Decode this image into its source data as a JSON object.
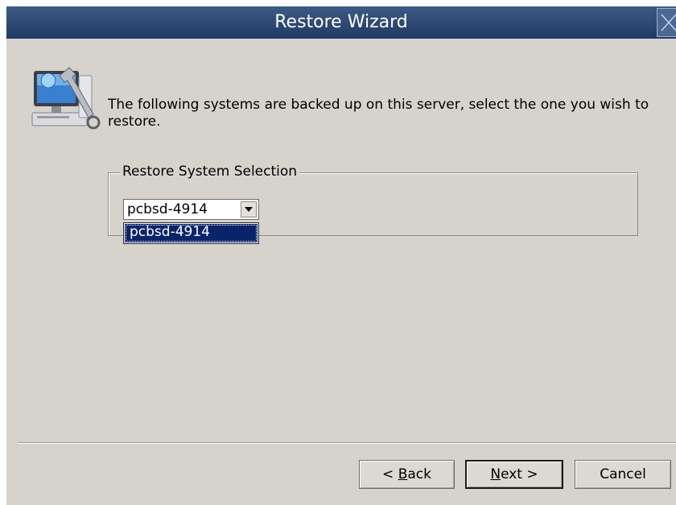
{
  "window": {
    "title": "Restore Wizard"
  },
  "intro": {
    "text": "The following systems are backed up on this server, select the one you wish to restore."
  },
  "group": {
    "legend": "Restore System Selection",
    "combo_value": "pcbsd-4914",
    "dropdown_items": [
      "pcbsd-4914"
    ]
  },
  "buttons": {
    "back": {
      "prefix": "< ",
      "mnemonic": "B",
      "rest": "ack"
    },
    "next": {
      "mnemonic": "N",
      "rest": "ext >"
    },
    "cancel": "Cancel"
  },
  "icons": {
    "wizard": "computer-tools-icon",
    "close": "close-icon",
    "dropdown": "chevron-down-icon"
  }
}
